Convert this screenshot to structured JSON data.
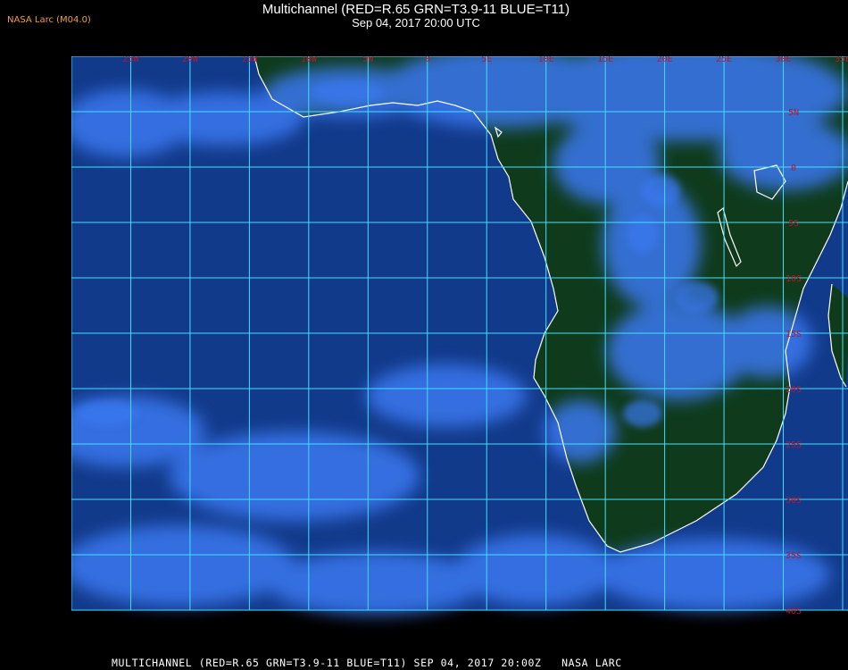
{
  "header": {
    "source_tag": "NASA Larc (M04.0)",
    "title": "Multichannel (RED=R.65 GRN=T3.9-11 BLUE=T11)",
    "subtitle": "Sep 04, 2017 20:00 UTC"
  },
  "footer": {
    "caption": "MULTICHANNEL (RED=R.65 GRN=T3.9-11 BLUE=T11) SEP 04, 2017 20:00Z   NASA LARC"
  },
  "map": {
    "lon_range": [
      -30,
      35
    ],
    "lat_range": [
      -40,
      10
    ],
    "grid_step_deg": 5,
    "grid_color": "#40e0ff",
    "coastline_color": "#ffffff",
    "label_color": "#c0142a",
    "ocean_color": "#123a8a",
    "land_color": "#0f3b1c",
    "cloud_color": "#3a78f0",
    "lon_labels": [
      {
        "lon": -25,
        "text": "25W"
      },
      {
        "lon": -20,
        "text": "20W"
      },
      {
        "lon": -15,
        "text": "15W"
      },
      {
        "lon": -10,
        "text": "10W"
      },
      {
        "lon": -5,
        "text": "5W"
      },
      {
        "lon": 0,
        "text": "0"
      },
      {
        "lon": 5,
        "text": "5E"
      },
      {
        "lon": 10,
        "text": "10E"
      },
      {
        "lon": 15,
        "text": "15E"
      },
      {
        "lon": 20,
        "text": "20E"
      },
      {
        "lon": 25,
        "text": "25E"
      },
      {
        "lon": 30,
        "text": "30E"
      },
      {
        "lon": 35,
        "text": "35E"
      }
    ],
    "lat_labels": [
      {
        "lat": 5,
        "text": "5N"
      },
      {
        "lat": 0,
        "text": "0"
      },
      {
        "lat": -5,
        "text": "5S"
      },
      {
        "lat": -10,
        "text": "10S"
      },
      {
        "lat": -15,
        "text": "15S"
      },
      {
        "lat": -20,
        "text": "20S"
      },
      {
        "lat": -25,
        "text": "25S"
      },
      {
        "lat": -30,
        "text": "30S"
      },
      {
        "lat": -35,
        "text": "35S"
      },
      {
        "lat": -40,
        "text": "40S"
      }
    ]
  }
}
